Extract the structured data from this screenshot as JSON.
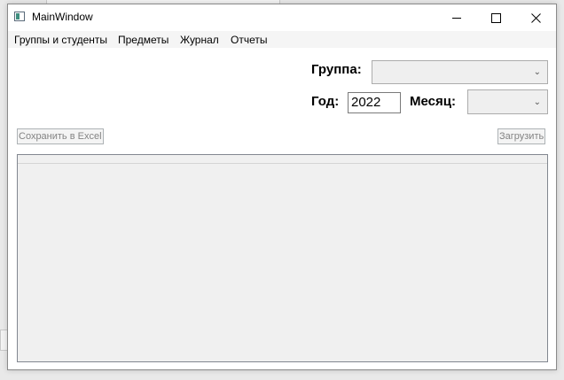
{
  "window": {
    "title": "MainWindow"
  },
  "menu": [
    {
      "label": "Группы и студенты"
    },
    {
      "label": "Предметы"
    },
    {
      "label": "Журнал"
    },
    {
      "label": "Отчеты"
    }
  ],
  "filters": {
    "group_label": "Группа:",
    "group_value": "",
    "year_label": "Год:",
    "year_value": "2022",
    "month_label": "Месяц:",
    "month_value": ""
  },
  "actions": {
    "save_excel_label": "Сохранить в Excel",
    "load_label": "Загрузить"
  }
}
